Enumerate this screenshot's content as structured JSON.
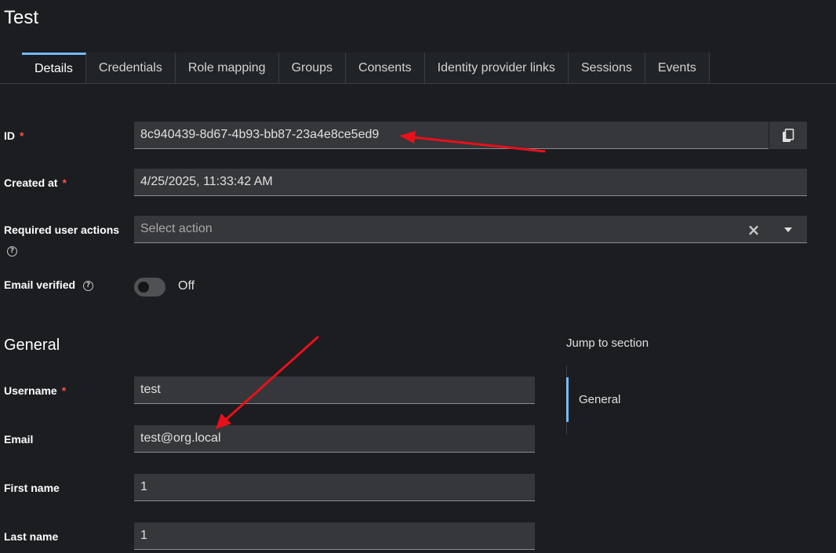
{
  "page": {
    "title": "Test"
  },
  "tabs": [
    {
      "label": "Details",
      "active": true
    },
    {
      "label": "Credentials"
    },
    {
      "label": "Role mapping"
    },
    {
      "label": "Groups"
    },
    {
      "label": "Consents"
    },
    {
      "label": "Identity provider links"
    },
    {
      "label": "Sessions"
    },
    {
      "label": "Events"
    }
  ],
  "form": {
    "id": {
      "label": "ID",
      "required": "*",
      "value": "8c940439-8d67-4b93-bb87-23a4e8ce5ed9"
    },
    "created_at": {
      "label": "Created at",
      "required": "*",
      "value": "4/25/2025, 11:33:42 AM"
    },
    "required_actions": {
      "label": "Required user actions",
      "placeholder": "Select action",
      "clear_symbol": "×"
    },
    "email_verified": {
      "label": "Email verified",
      "state": "Off"
    }
  },
  "general": {
    "title": "General",
    "username": {
      "label": "Username",
      "required": "*",
      "value": "test"
    },
    "email": {
      "label": "Email",
      "value": "test@org.local"
    },
    "first_name": {
      "label": "First name",
      "value": "1"
    },
    "last_name": {
      "label": "Last name",
      "value": "1"
    }
  },
  "jump": {
    "title": "Jump to section",
    "items": [
      {
        "label": "General"
      }
    ]
  },
  "icons": {
    "copy": "copy-icon",
    "help": "help-circle-icon",
    "clear": "close-icon",
    "caret": "caret-down-icon"
  },
  "colors": {
    "background": "#1b1d21",
    "field": "#36373a",
    "accent": "#73bcf7",
    "required": "#fe5142",
    "annotation": "#e8101a"
  }
}
